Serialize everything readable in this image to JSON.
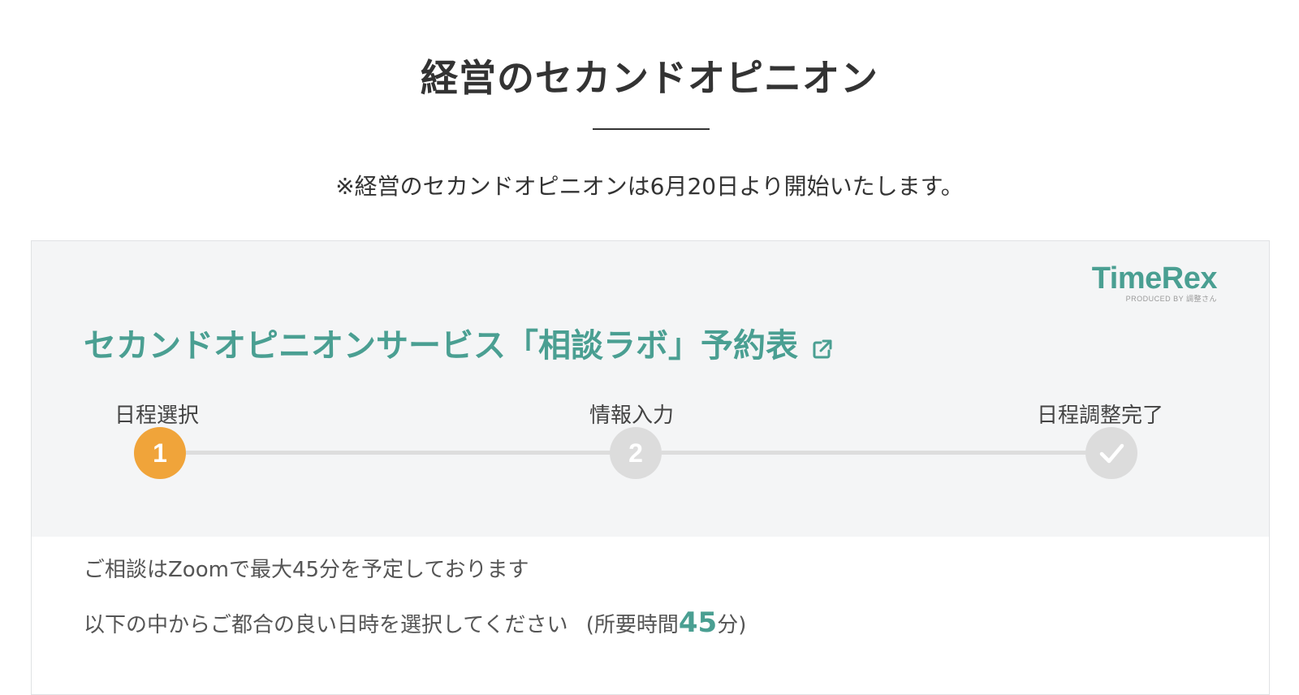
{
  "page": {
    "title": "経営のセカンドオピニオン",
    "notice": "※経営のセカンドオピニオンは6月20日より開始いたします。"
  },
  "widget": {
    "brand": {
      "name": "TimeRex",
      "sub": "PRODUCED BY 調整さん",
      "color": "#4a9f92"
    },
    "form_title": "セカンドオピニオンサービス「相談ラボ」予約表",
    "external_link_icon": "external-link-icon",
    "steps": [
      {
        "label": "日程選択",
        "marker": "1",
        "state": "active"
      },
      {
        "label": "情報入力",
        "marker": "2",
        "state": "inactive"
      },
      {
        "label": "日程調整完了",
        "marker": "check-icon",
        "state": "inactive"
      }
    ],
    "colors": {
      "accent": "#4a9f92",
      "active_step": "#f0a43a",
      "inactive_step": "#dcdcdc"
    },
    "description": "ご相談はZoomで最大45分を予定しております",
    "instruction": {
      "text": "以下の中からご都合の良い日時を選択してください",
      "duration_prefix": "(所要時間",
      "duration_value": "45",
      "duration_suffix": "分)"
    }
  }
}
